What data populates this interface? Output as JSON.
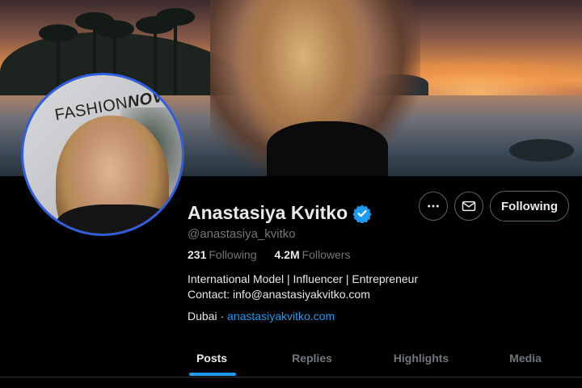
{
  "profile": {
    "name": "Anastasiya Kvitko",
    "handle": "@anastasiya_kvitko",
    "verified": true,
    "stats": {
      "following_count": "231",
      "following_label": "Following",
      "followers_count": "4.2M",
      "followers_label": "Followers"
    },
    "bio_line1": "International Model | Influencer | Entrepreneur",
    "bio_line2": "Contact: info@anastasiyakvitko.com",
    "location": "Dubai",
    "separator": " · ",
    "website": "anastasiyakvitko.com"
  },
  "avatar": {
    "brand_text_regular": "FASHION",
    "brand_text_bold": "NOVA"
  },
  "actions": {
    "more_icon": "more-horizontal-icon",
    "mail_icon": "mail-icon",
    "following_label": "Following"
  },
  "tabs": [
    {
      "label": "Posts",
      "active": true
    },
    {
      "label": "Replies",
      "active": false
    },
    {
      "label": "Highlights",
      "active": false
    },
    {
      "label": "Media",
      "active": false
    }
  ],
  "colors": {
    "accent": "#1d9bf0",
    "verified": "#1d9bf0",
    "avatar_ring": "#2f5ee0",
    "muted_text": "#71767b",
    "background": "#000000"
  }
}
